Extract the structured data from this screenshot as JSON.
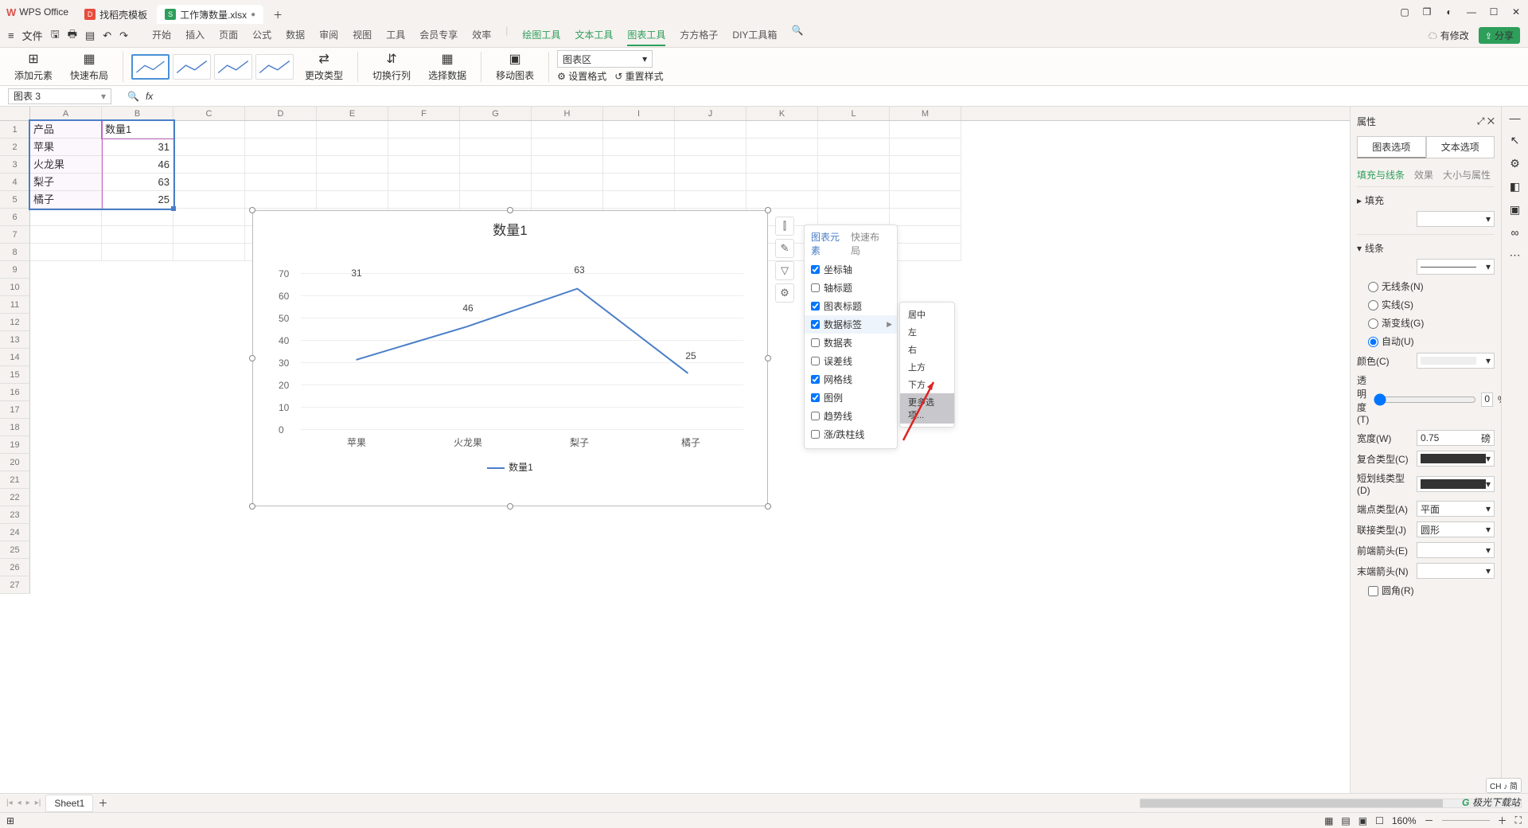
{
  "app": {
    "name": "WPS Office"
  },
  "titletabs": [
    {
      "label": "找稻壳模板",
      "kind": "d"
    },
    {
      "label": "工作簿数量.xlsx",
      "kind": "s",
      "active": true
    }
  ],
  "menu": {
    "file": "文件",
    "tabs": [
      "开始",
      "插入",
      "页面",
      "公式",
      "数据",
      "审阅",
      "视图",
      "工具",
      "会员专享",
      "效率"
    ],
    "green_tabs": [
      "绘图工具",
      "文本工具",
      "图表工具",
      "方方格子",
      "DIY工具箱"
    ],
    "active": "图表工具",
    "changes": "有修改",
    "share": "分享"
  },
  "ribbon": {
    "add_elem": "添加元素",
    "quick_layout": "快速布局",
    "change_type": "更改类型",
    "swap": "切换行列",
    "select_data": "选择数据",
    "move_chart": "移动图表",
    "area_dd": "图表区",
    "set_fmt": "设置格式",
    "reset": "重置样式"
  },
  "namebox": "图表 3",
  "cols": [
    "A",
    "B",
    "C",
    "D",
    "E",
    "F",
    "G",
    "H",
    "I",
    "J",
    "K",
    "L",
    "M"
  ],
  "table": {
    "header": [
      "产品",
      "数量1"
    ],
    "rows": [
      [
        "苹果",
        "31"
      ],
      [
        "火龙果",
        "46"
      ],
      [
        "梨子",
        "63"
      ],
      [
        "橘子",
        "25"
      ]
    ]
  },
  "chart_data": {
    "type": "line",
    "title": "数量1",
    "categories": [
      "苹果",
      "火龙果",
      "梨子",
      "橘子"
    ],
    "series": [
      {
        "name": "数量1",
        "values": [
          31,
          46,
          63,
          25
        ]
      }
    ],
    "ylim": [
      0,
      70
    ],
    "yticks": [
      0,
      10,
      20,
      30,
      40,
      50,
      60,
      70
    ],
    "legend": "数量1"
  },
  "popup1": {
    "tabs": [
      "图表元素",
      "快速布局"
    ],
    "items": [
      {
        "label": "坐标轴",
        "checked": true
      },
      {
        "label": "轴标题",
        "checked": false
      },
      {
        "label": "图表标题",
        "checked": true
      },
      {
        "label": "数据标签",
        "checked": true,
        "arrow": true,
        "hov": true
      },
      {
        "label": "数据表",
        "checked": false
      },
      {
        "label": "误差线",
        "checked": false
      },
      {
        "label": "网格线",
        "checked": true
      },
      {
        "label": "图例",
        "checked": true
      },
      {
        "label": "趋势线",
        "checked": false
      },
      {
        "label": "涨/跌柱线",
        "checked": false
      }
    ]
  },
  "popup2": {
    "items": [
      "居中",
      "左",
      "右",
      "上方",
      "下方",
      "更多选项..."
    ],
    "hov": "更多选项..."
  },
  "panel": {
    "title": "属性",
    "tabs": [
      "图表选项",
      "文本选项"
    ],
    "subtabs": [
      "填充与线条",
      "效果",
      "大小与属性"
    ],
    "fill": "填充",
    "line": "线条",
    "radios": [
      "无线条(N)",
      "实线(S)",
      "渐变线(G)",
      "自动(U)"
    ],
    "radio_sel": "自动(U)",
    "color": "颜色(C)",
    "opacity": "透明度(T)",
    "opacity_v": "0",
    "opacity_u": "%",
    "width": "宽度(W)",
    "width_v": "0.75",
    "width_u": "磅",
    "comp": "复合类型(C)",
    "dash": "短划线类型(D)",
    "cap": "端点类型(A)",
    "cap_v": "平面",
    "join": "联接类型(J)",
    "join_v": "圆形",
    "arr1": "前端箭头(E)",
    "arr2": "末端箭头(N)",
    "round": "圆角(R)"
  },
  "sheet": {
    "name": "Sheet1"
  },
  "status": {
    "zoom": "160%",
    "ind": "◎"
  },
  "ime": "CH ♪ 简",
  "watermark": "极光下载站"
}
